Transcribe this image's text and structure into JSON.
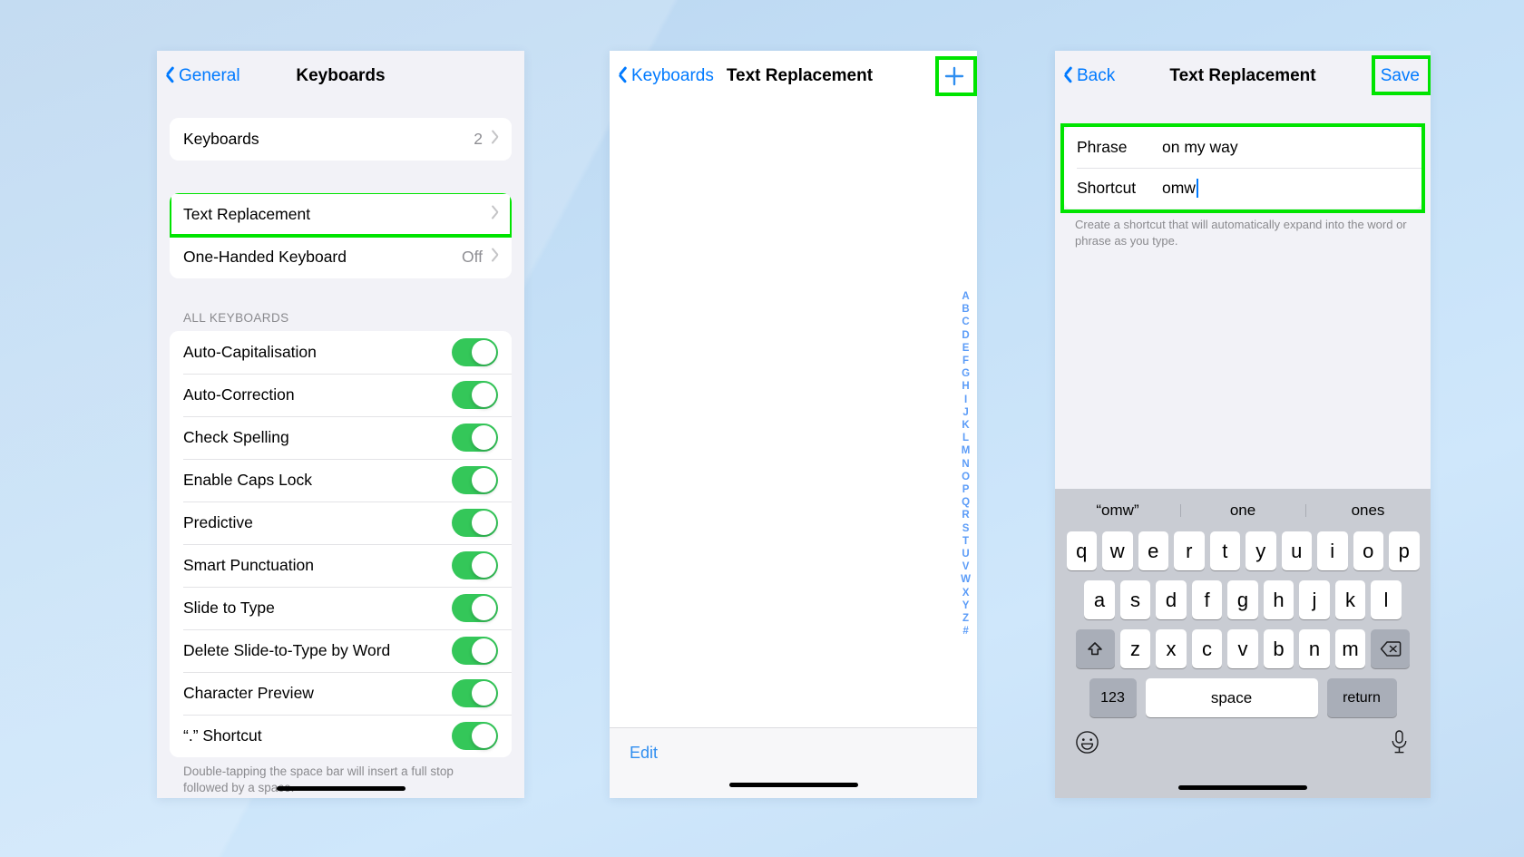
{
  "theme": {
    "accent_blue": "#007aff",
    "toggle_green": "#34c759",
    "highlight_green": "#00e400",
    "group_bg": "#f2f2f7",
    "keyboard_bg": "#c9ccd3"
  },
  "panel1": {
    "nav": {
      "back_label": "General",
      "title": "Keyboards",
      "back_icon": "chevron-left-icon"
    },
    "group1": [
      {
        "label": "Keyboards",
        "value": "2",
        "chevron": true
      }
    ],
    "group2": [
      {
        "label": "Text Replacement",
        "value": "",
        "chevron": true,
        "highlighted": true
      },
      {
        "label": "One-Handed Keyboard",
        "value": "Off",
        "chevron": true,
        "highlighted": false
      }
    ],
    "section_header": "ALL KEYBOARDS",
    "toggles": [
      {
        "label": "Auto-Capitalisation",
        "on": true
      },
      {
        "label": "Auto-Correction",
        "on": true
      },
      {
        "label": "Check Spelling",
        "on": true
      },
      {
        "label": "Enable Caps Lock",
        "on": true
      },
      {
        "label": "Predictive",
        "on": true
      },
      {
        "label": "Smart Punctuation",
        "on": true
      },
      {
        "label": "Slide to Type",
        "on": true
      },
      {
        "label": "Delete Slide-to-Type by Word",
        "on": true
      },
      {
        "label": "Character Preview",
        "on": true
      },
      {
        "label": "“.” Shortcut",
        "on": true
      }
    ],
    "footer": "Double-tapping the space bar will insert a full stop followed by a space."
  },
  "panel2": {
    "nav": {
      "back_label": "Keyboards",
      "title": "Text Replacement",
      "add_icon": "plus-icon",
      "back_icon": "chevron-left-icon"
    },
    "alpha_index": [
      "A",
      "B",
      "C",
      "D",
      "E",
      "F",
      "G",
      "H",
      "I",
      "J",
      "K",
      "L",
      "M",
      "N",
      "O",
      "P",
      "Q",
      "R",
      "S",
      "T",
      "U",
      "V",
      "W",
      "X",
      "Y",
      "Z",
      "#"
    ],
    "edit_label": "Edit"
  },
  "panel3": {
    "nav": {
      "back_label": "Back",
      "title": "Text Replacement",
      "save_label": "Save",
      "back_icon": "chevron-left-icon"
    },
    "form": {
      "phrase_label": "Phrase",
      "phrase_value": "on my way",
      "shortcut_label": "Shortcut",
      "shortcut_value": "omw"
    },
    "help_text": "Create a shortcut that will automatically expand into the word or phrase as you type.",
    "keyboard": {
      "suggestions": [
        "“omw”",
        "one",
        "ones"
      ],
      "row1": [
        "q",
        "w",
        "e",
        "r",
        "t",
        "y",
        "u",
        "i",
        "o",
        "p"
      ],
      "row2": [
        "a",
        "s",
        "d",
        "f",
        "g",
        "h",
        "j",
        "k",
        "l"
      ],
      "row3": [
        "z",
        "x",
        "c",
        "v",
        "b",
        "n",
        "m"
      ],
      "shift_icon": "shift-up-arrow-icon",
      "backspace_icon": "backspace-delete-icon",
      "numbers_label": "123",
      "space_label": "space",
      "return_label": "return",
      "emoji_icon": "smiley-face-icon",
      "mic_icon": "microphone-icon"
    }
  }
}
